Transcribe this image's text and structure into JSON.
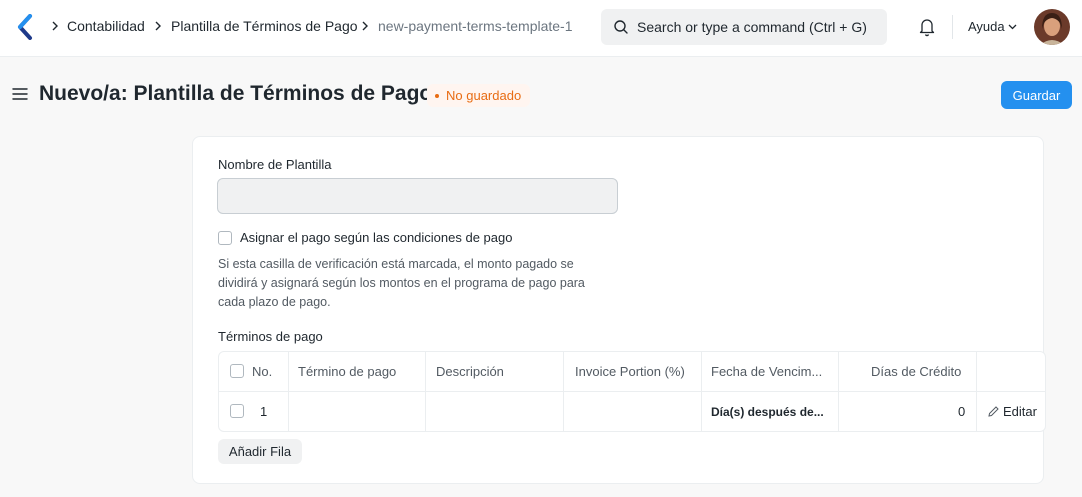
{
  "navbar": {
    "breadcrumbs": [
      "Contabilidad",
      "Plantilla de Términos de Pago",
      "new-payment-terms-template-1"
    ],
    "search_placeholder": "Search or type a command (Ctrl + G)",
    "help_label": "Ayuda",
    "icons": {
      "logo": "app-logo",
      "search": "search-icon",
      "notifications": "bell-icon",
      "help_dropdown": "chevron-down-icon"
    }
  },
  "page": {
    "title": "Nuevo/a: Plantilla de Términos de Pago",
    "status_badge": "No guardado",
    "save_label": "Guardar"
  },
  "form": {
    "template_name_label": "Nombre de Plantilla",
    "template_name_value": "",
    "allocate_checkbox_label": "Asignar el pago según las condiciones de pago",
    "allocate_checked": false,
    "allocate_help": "Si esta casilla de verificación está marcada, el monto pagado se dividirá y asignará según los montos en el programa de pago para cada plazo de pago.",
    "terms_label": "Términos de pago",
    "table": {
      "columns": [
        "No.",
        "Término de pago",
        "Descripción",
        "Invoice Portion (%)",
        "Fecha de Vencim...",
        "Días de Crédito"
      ],
      "rows": [
        {
          "no": "1",
          "payment_term": "",
          "description": "",
          "invoice_portion": "",
          "due_date_based_on": "Día(s) después de...",
          "credit_days": "0",
          "edit_label": "Editar"
        }
      ]
    },
    "add_row_label": "Añadir Fila"
  },
  "colors": {
    "primary": "#2490ef",
    "badge_text": "#e86c13",
    "badge_bg": "#fff5f0"
  }
}
